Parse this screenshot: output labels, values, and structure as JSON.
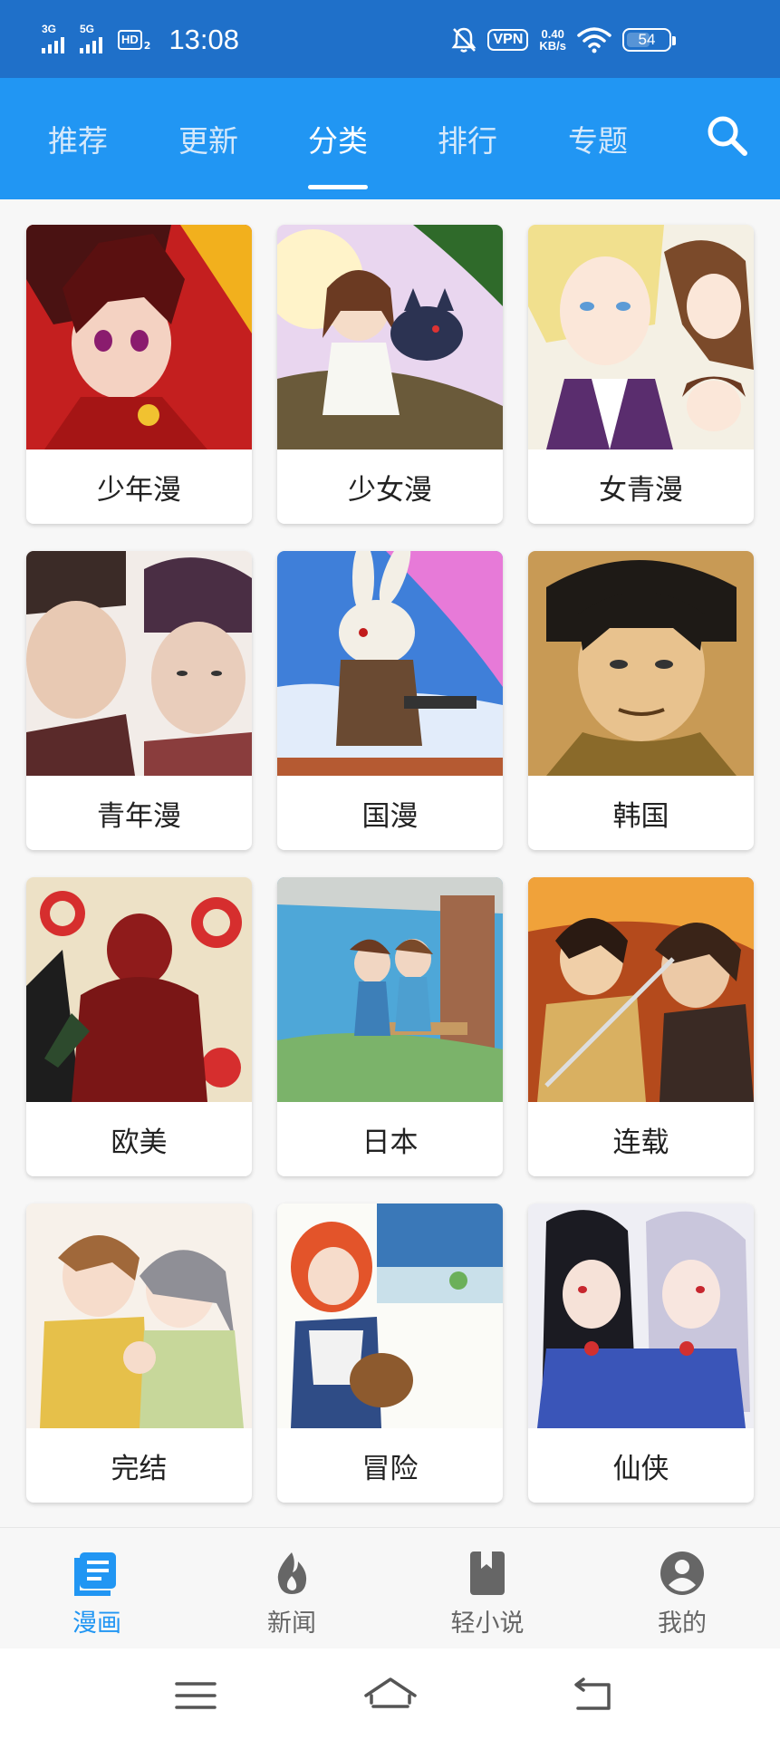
{
  "status_bar": {
    "signal1_label": "3G",
    "signal2_label": "5G",
    "hd_label": "HD",
    "hd_sub": "2",
    "time": "13:08",
    "vpn_label": "VPN",
    "speed_value": "0.40",
    "speed_unit": "KB/s",
    "battery_level": "54"
  },
  "top_tabs": {
    "items": [
      {
        "label": "推荐"
      },
      {
        "label": "更新"
      },
      {
        "label": "分类"
      },
      {
        "label": "排行"
      },
      {
        "label": "专题"
      }
    ],
    "active_index": 2
  },
  "categories": [
    {
      "label": "少年漫",
      "image": "red-haired-boy-art"
    },
    {
      "label": "少女漫",
      "image": "girl-with-cat-art"
    },
    {
      "label": "女青漫",
      "image": "blonde-prince-and-girl-art"
    },
    {
      "label": "青年漫",
      "image": "two-men-portrait-art"
    },
    {
      "label": "国漫",
      "image": "armed-rabbit-art"
    },
    {
      "label": "韩国",
      "image": "warrior-man-portrait-art"
    },
    {
      "label": "欧美",
      "image": "red-hooded-figure-targets-art"
    },
    {
      "label": "日本",
      "image": "two-girls-bench-art"
    },
    {
      "label": "连载",
      "image": "two-swordsmen-art"
    },
    {
      "label": "完结",
      "image": "couple-holding-hands-art"
    },
    {
      "label": "冒险",
      "image": "orange-haired-girl-basket-art"
    },
    {
      "label": "仙侠",
      "image": "two-cultivator-girls-art"
    }
  ],
  "bottom_nav": {
    "items": [
      {
        "label": "漫画",
        "icon": "comic-book-icon"
      },
      {
        "label": "新闻",
        "icon": "flame-icon"
      },
      {
        "label": "轻小说",
        "icon": "book-icon"
      },
      {
        "label": "我的",
        "icon": "account-icon"
      }
    ],
    "active_index": 0
  },
  "colors": {
    "status_bar": "#1f70c9",
    "tab_bar": "#2196f3",
    "accent": "#2196f3",
    "inactive_nav": "#666666"
  }
}
